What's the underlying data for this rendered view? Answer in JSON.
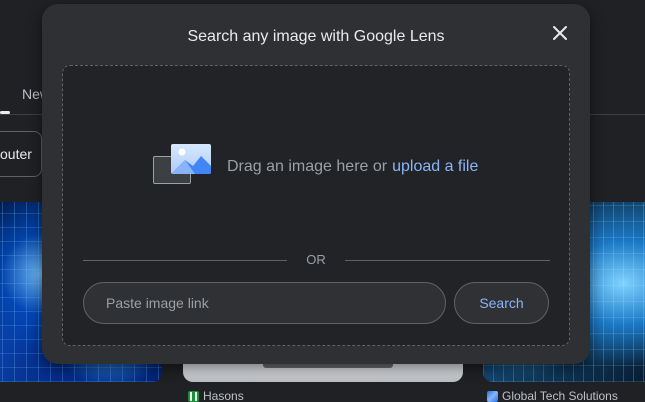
{
  "background": {
    "tab_partial": "New",
    "chip_partial": "outer",
    "sources": [
      {
        "name": "Hasons",
        "icon": "hasons-favicon-icon"
      },
      {
        "name": "Global Tech Solutions",
        "icon": "global-tech-solutions-favicon-icon"
      }
    ]
  },
  "modal": {
    "title": "Search any image with Google Lens",
    "close_icon": "close-icon",
    "drop_text": "Drag an image here or",
    "upload_link": "upload a file",
    "or_text": "OR",
    "link_input": {
      "placeholder": "Paste image link",
      "value": ""
    },
    "search_button": "Search"
  },
  "colors": {
    "link": "#8ab4f8",
    "modal_bg": "#2f3033",
    "drop_zone_bg": "#222326",
    "page_bg": "#202124"
  }
}
